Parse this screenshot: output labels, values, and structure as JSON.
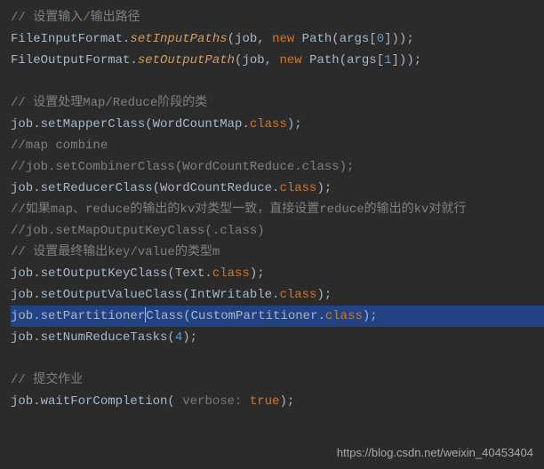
{
  "lines": {
    "c1": "// 设置输入/输出路径",
    "l2_a": "FileInputFormat.",
    "l2_m": "setInputPaths",
    "l2_b": "(job, ",
    "l2_new": "new",
    "l2_c": " Path(args[",
    "l2_n": "0",
    "l2_d": "]));",
    "l3_a": "FileOutputFormat.",
    "l3_m": "setOutputPath",
    "l3_b": "(job, ",
    "l3_new": "new",
    "l3_c": " Path(args[",
    "l3_n": "1",
    "l3_d": "]));",
    "c2": "// 设置处理Map/Reduce阶段的类",
    "l5_a": "job.setMapperClass(WordCountMap.",
    "l5_cls": "class",
    "l5_b": ");",
    "c3": "//map combine",
    "c4": "//job.setCombinerClass(WordCountReduce.class);",
    "l8_a": "job.setReducerClass(WordCountReduce.",
    "l8_cls": "class",
    "l8_b": ");",
    "c5": "//如果map、reduce的输出的kv对类型一致，直接设置reduce的输出的kv对就行",
    "c6": "//job.setMapOutputKeyClass(.class)",
    "c7": "// 设置最终输出key/value的类型m",
    "l12_a": "job.setOutputKeyClass(Text.",
    "l12_cls": "class",
    "l12_b": ");",
    "l13_a": "job.setOutputValueClass(IntWritable.",
    "l13_cls": "class",
    "l13_b": ");",
    "l14_a": "job.setPartitioner",
    "l14_a2": "Class(CustomPartitioner.",
    "l14_cls": "class",
    "l14_b": ");",
    "l15_a": "job.setNumReduceTasks(",
    "l15_n": "4",
    "l15_b": ");",
    "c8": "// 提交作业",
    "l17_a": "job.waitForCompletion(",
    "l17_hint": " verbose: ",
    "l17_kw": "true",
    "l17_b": ");"
  },
  "watermark": "https://blog.csdn.net/weixin_40453404"
}
